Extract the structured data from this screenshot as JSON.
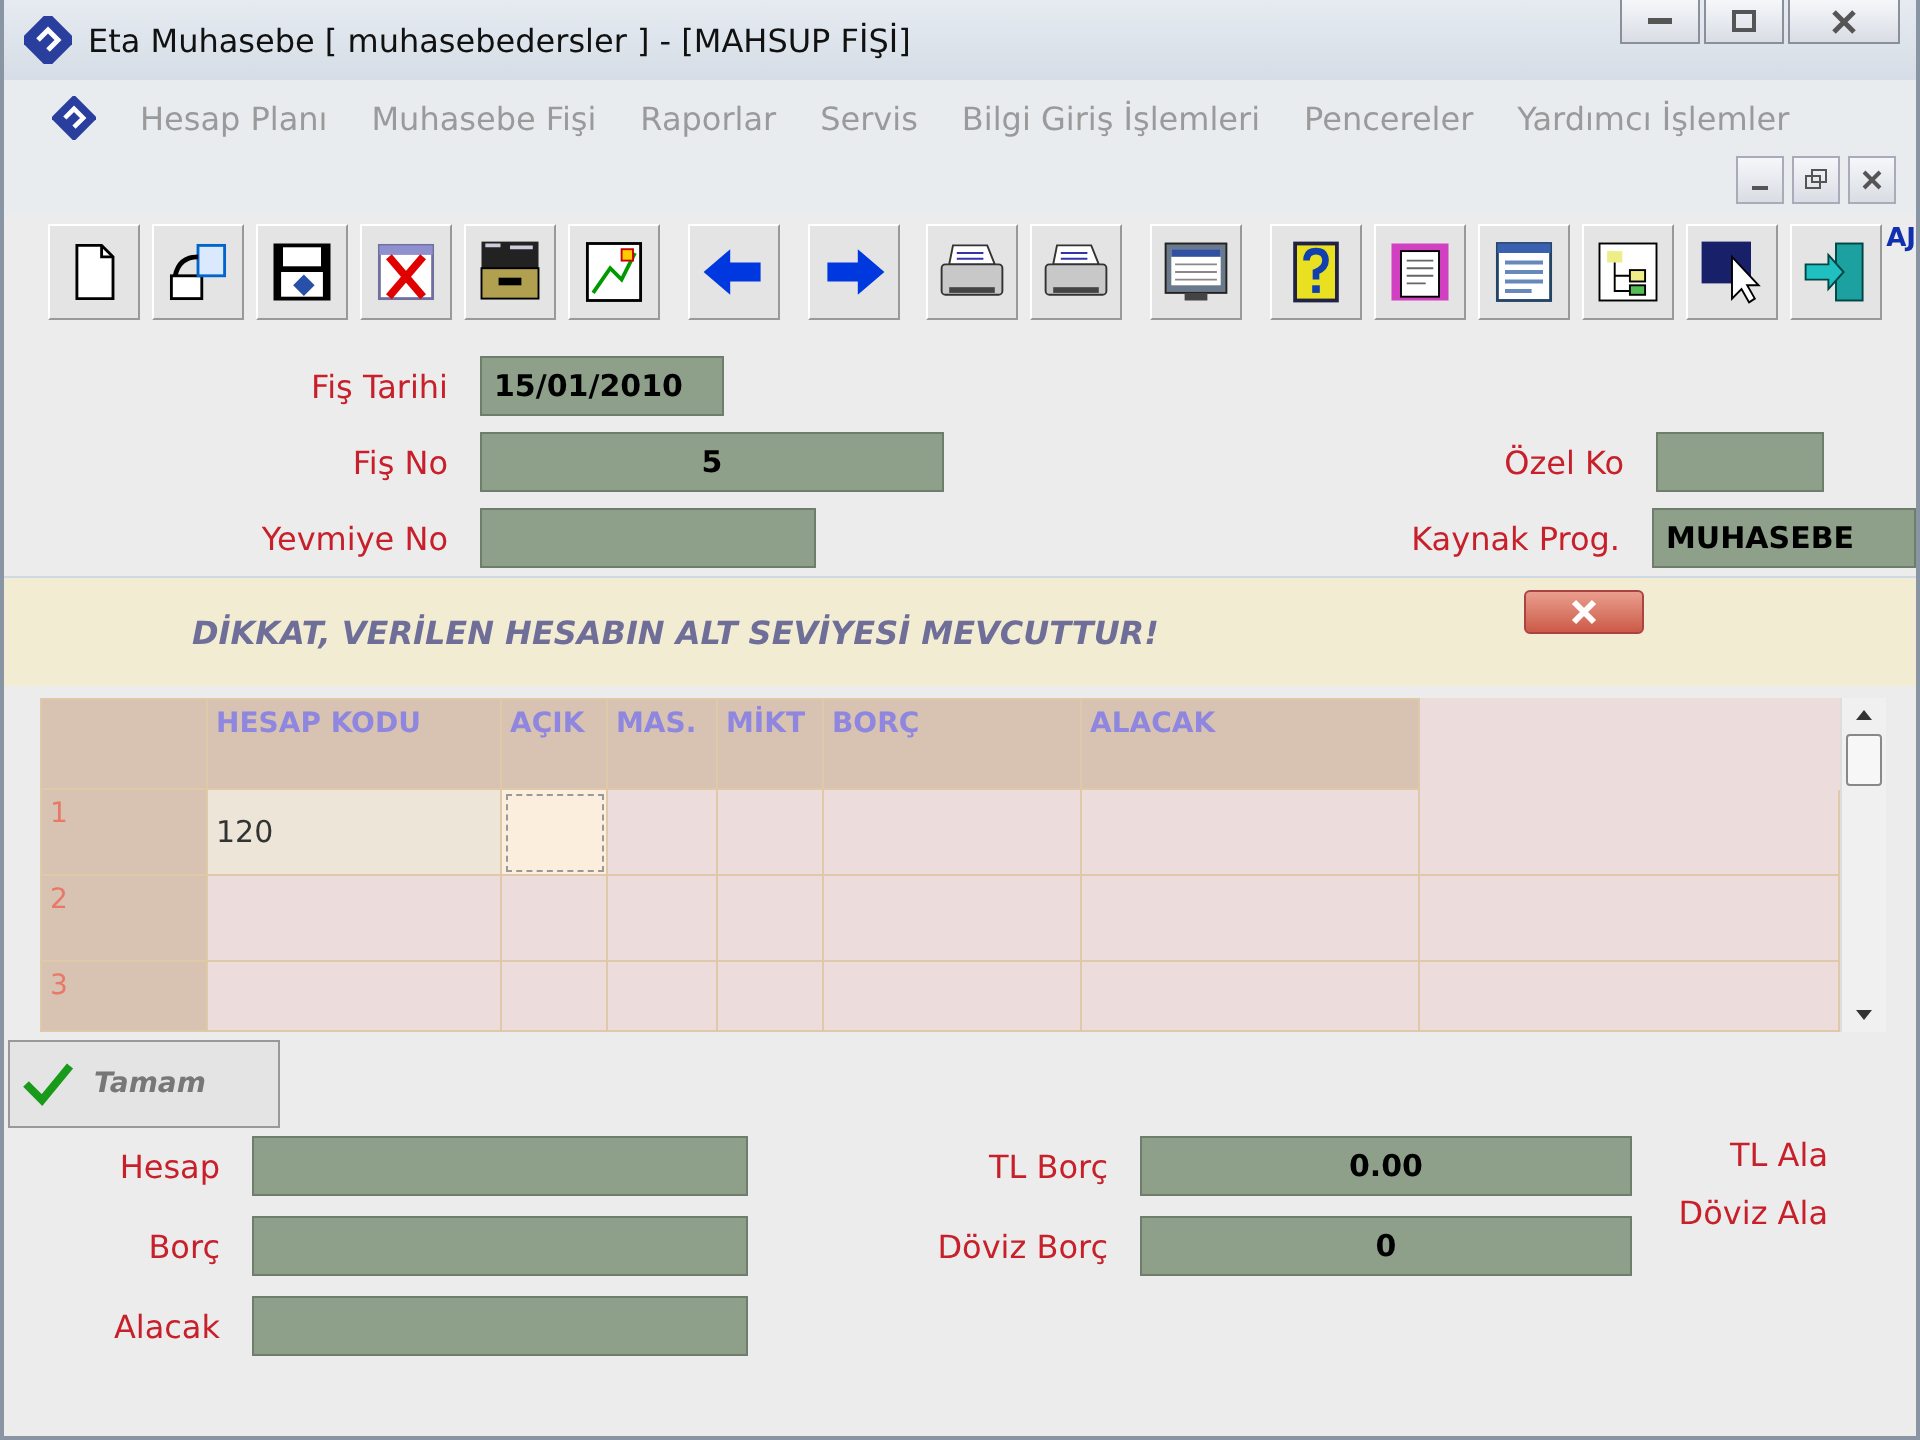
{
  "window": {
    "title": "Eta Muhasebe [ muhasebedersler ] - [MAHSUP FİŞİ]"
  },
  "menu": [
    "Hesap Planı",
    "Muhasebe Fişi",
    "Raporlar",
    "Servis",
    "Bilgi Giriş İşlemleri",
    "Pencereler",
    "Yardımcı İşlemler"
  ],
  "toolbar": {
    "buttons": [
      {
        "kind": "new"
      },
      {
        "kind": "export"
      },
      {
        "kind": "save"
      },
      {
        "kind": "delete"
      },
      {
        "kind": "drawer"
      },
      {
        "kind": "chart"
      },
      {
        "kind": "left"
      },
      {
        "kind": "right"
      },
      {
        "kind": "printer"
      },
      {
        "kind": "printer"
      },
      {
        "kind": "screen"
      },
      {
        "kind": "help"
      },
      {
        "kind": "document"
      },
      {
        "kind": "form"
      },
      {
        "kind": "tree"
      },
      {
        "kind": "pointer"
      },
      {
        "kind": "exit"
      }
    ],
    "badge": "AJ"
  },
  "form": {
    "date": {
      "label": "Fiş Tarihi",
      "value": "15/01/2010"
    },
    "voucher_no": {
      "label": "Fiş No",
      "value": "5"
    },
    "special_code": {
      "label": "Özel Ko"
    },
    "journal_no": {
      "label": "Yevmiye No"
    },
    "source_program": {
      "label": "Kaynak Prog.",
      "value": "MUHASEBE"
    }
  },
  "dialog": {
    "message": "DİKKAT, VERİLEN HESABIN ALT SEVİYESİ MEVCUTTUR!",
    "ok_button": "Tamam"
  },
  "grid": {
    "columns": [
      "HESAP KODU",
      "AÇIK",
      "MAS.",
      "MİKT",
      "BORÇ",
      "ALACAK"
    ],
    "rows": [
      {
        "number": "1",
        "account_code": "120"
      },
      {
        "number": "2"
      },
      {
        "number": "3"
      }
    ]
  },
  "summary": {
    "left": [
      {
        "label": "Hesap"
      },
      {
        "label": "Borç"
      },
      {
        "label": "Alacak"
      }
    ],
    "middle": [
      {
        "label": "TL Borç",
        "value": "0.00"
      },
      {
        "label": "Döviz Borç",
        "value": "0"
      }
    ],
    "right": [
      {
        "label": "TL Ala"
      },
      {
        "label": "Döviz Ala"
      }
    ]
  }
}
